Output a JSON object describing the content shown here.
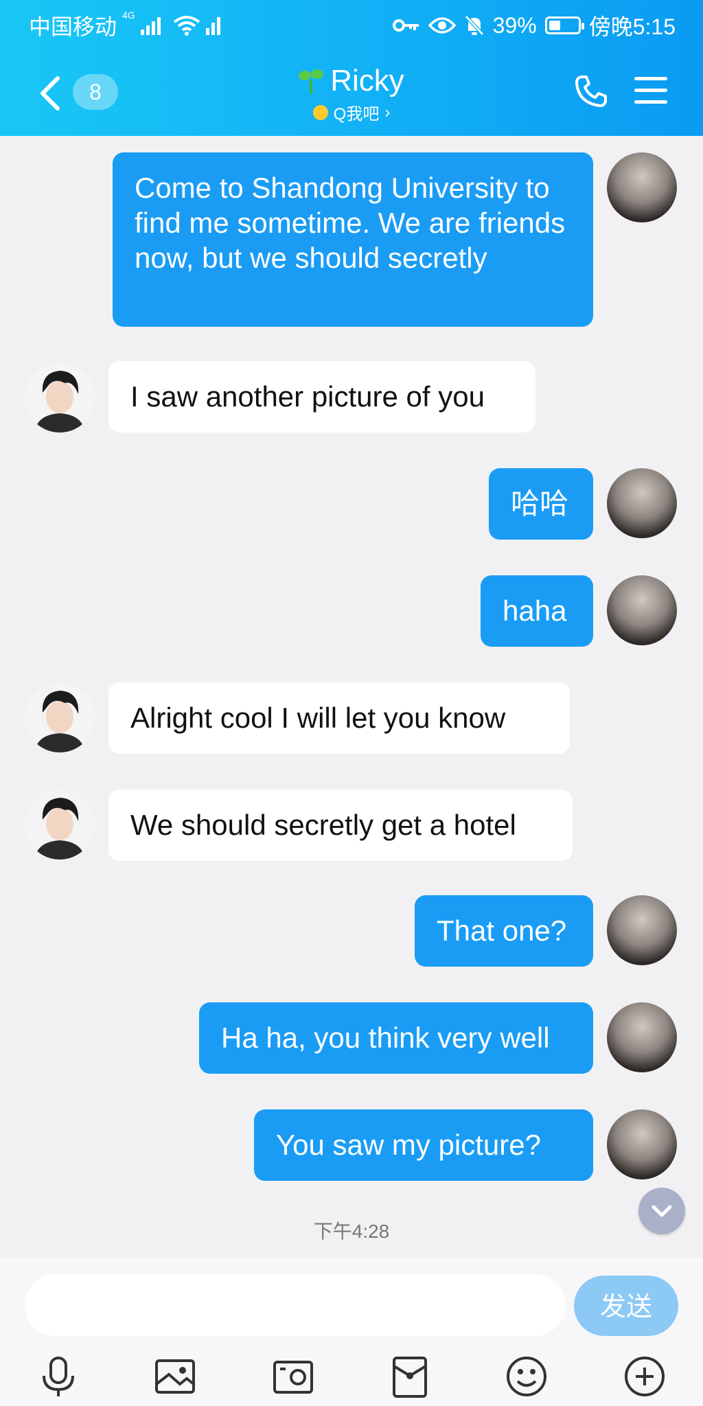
{
  "status_bar": {
    "carrier": "中国移动",
    "net_badge": "4G",
    "battery": "39%",
    "battery_level": 0.39,
    "time": "傍晚5:15"
  },
  "header": {
    "unread_count": "8",
    "contact_name": "Ricky",
    "subtitle": "Q我吧",
    "colors": {
      "bar_start": "#19c7f5",
      "bar_end": "#0a9bf2"
    }
  },
  "messages": [
    {
      "from": "me",
      "text": "Come to Shandong University to find me sometime. We are friends now, but we should secretly"
    },
    {
      "from": "them",
      "text": "I saw another picture of you"
    },
    {
      "from": "me",
      "text": "哈哈"
    },
    {
      "from": "me",
      "text": "haha"
    },
    {
      "from": "them",
      "text": "Alright cool I will let you know"
    },
    {
      "from": "them",
      "text": "We should secretly get a hotel"
    },
    {
      "from": "me",
      "text": "That one?"
    },
    {
      "from": "me",
      "text": "Ha ha, you think very well"
    },
    {
      "from": "me",
      "text": "You saw my picture?"
    }
  ],
  "timestamp": "下午4:28",
  "composer": {
    "input_value": "",
    "send_label": "发送"
  },
  "toolbar_icons": [
    "microphone-icon",
    "image-icon",
    "camera-icon",
    "red-packet-icon",
    "emoji-icon",
    "plus-icon"
  ],
  "bubble_colors": {
    "outgoing": "#1a9cf5",
    "incoming": "#ffffff"
  }
}
